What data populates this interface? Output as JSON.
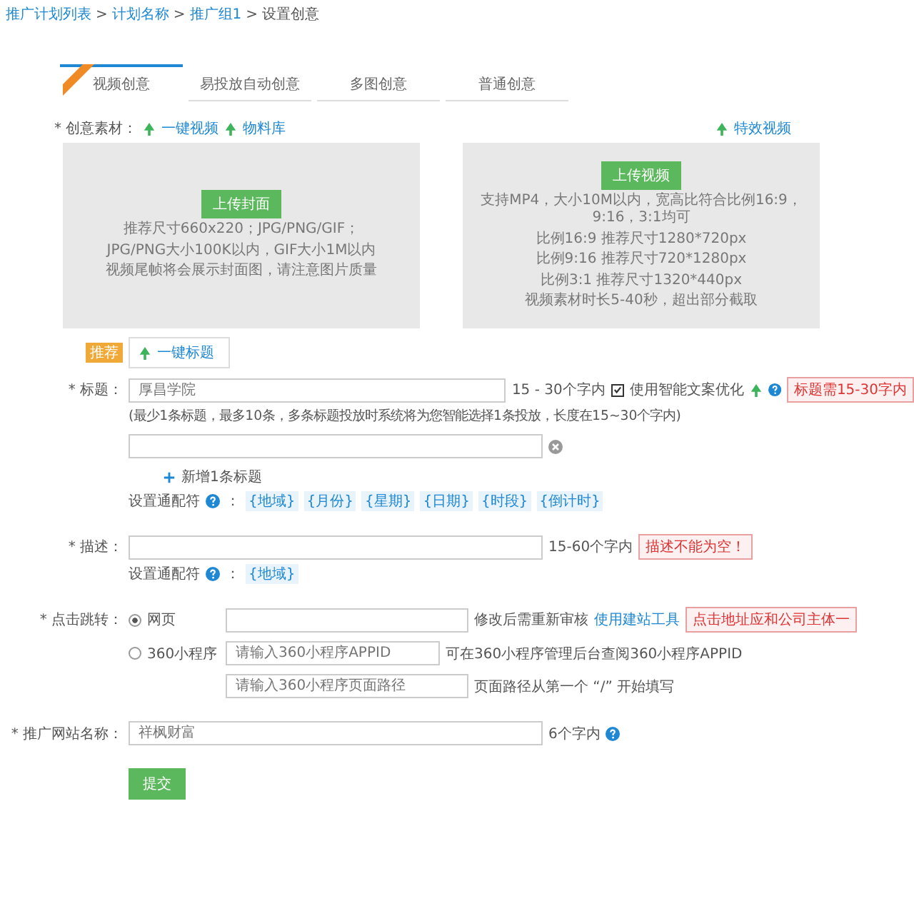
{
  "breadcrumb": {
    "separator": ">",
    "items": [
      "推广计划列表",
      "计划名称",
      "推广组1",
      "设置创意"
    ]
  },
  "tabs": [
    {
      "label": "视频创意",
      "selected": true,
      "ribbon": true
    },
    {
      "label": "易投放自动创意",
      "selected": false,
      "ribbon": false
    },
    {
      "label": "多图创意",
      "selected": false,
      "ribbon": false
    },
    {
      "label": "普通创意",
      "selected": false,
      "ribbon": false
    }
  ],
  "material": {
    "label": "* 创意素材：",
    "links": [
      "一键视频",
      "物料库"
    ],
    "right_link": "特效视频",
    "cover_box": {
      "button": "上传封面",
      "lines": [
        "推荐尺寸660x220；JPG/PNG/GIF；",
        "JPG/PNG大小100K以内，GIF大小1M以内",
        "视频尾帧将会展示封面图，请注意图片质量"
      ]
    },
    "video_box": {
      "button": "上传视频",
      "lines": [
        "支持MP4，大小10M以内，宽高比符合比例16:9，9:16，3:1均可",
        "比例16:9 推荐尺寸1280*720px",
        "比例9:16 推荐尺寸720*1280px",
        "比例3:1 推荐尺寸1320*440px",
        "视频素材时长5-40秒，超出部分截取"
      ]
    }
  },
  "title_tool": {
    "badge": "推荐",
    "button": "一键标题"
  },
  "title": {
    "label": "* 标题：",
    "placeholder": "厚昌学院",
    "hint": "15 - 30个字内",
    "smart_copy": {
      "label": "使用智能文案优化",
      "checked": true
    },
    "error": "标题需15-30字内",
    "note": "(最少1条标题，最多10条，多条标题投放时系统将为您智能选择1条投放，长度在15~30个字内)",
    "add_link": "新增1条标题",
    "wildcard_label": "设置通配符",
    "colon": "：",
    "wildcards": [
      "{地域}",
      "{月份}",
      "{星期}",
      "{日期}",
      "{时段}",
      "{倒计时}"
    ]
  },
  "description": {
    "label": "* 描述：",
    "hint": "15-60个字内",
    "error": "描述不能为空！",
    "wildcard_label": "设置通配符",
    "colon": "：",
    "wildcards": [
      "{地域}"
    ]
  },
  "click": {
    "label": "* 点击跳转：",
    "options": [
      {
        "label": "网页",
        "selected": true
      },
      {
        "label": "360小程序",
        "selected": false
      }
    ],
    "web_hint": "修改后需重新审核",
    "web_link": "使用建站工具",
    "web_error": "点击地址应和公司主体一",
    "appid_placeholder": "请输入360小程序APPID",
    "appid_hint": "可在360小程序管理后台查阅360小程序APPID",
    "path_placeholder": "请输入360小程序页面路径",
    "path_hint": "页面路径从第一个 “/” 开始填写"
  },
  "site_name": {
    "label": "* 推广网站名称：",
    "placeholder": "祥枫财富",
    "hint": "6个字内"
  },
  "submit": "提交"
}
